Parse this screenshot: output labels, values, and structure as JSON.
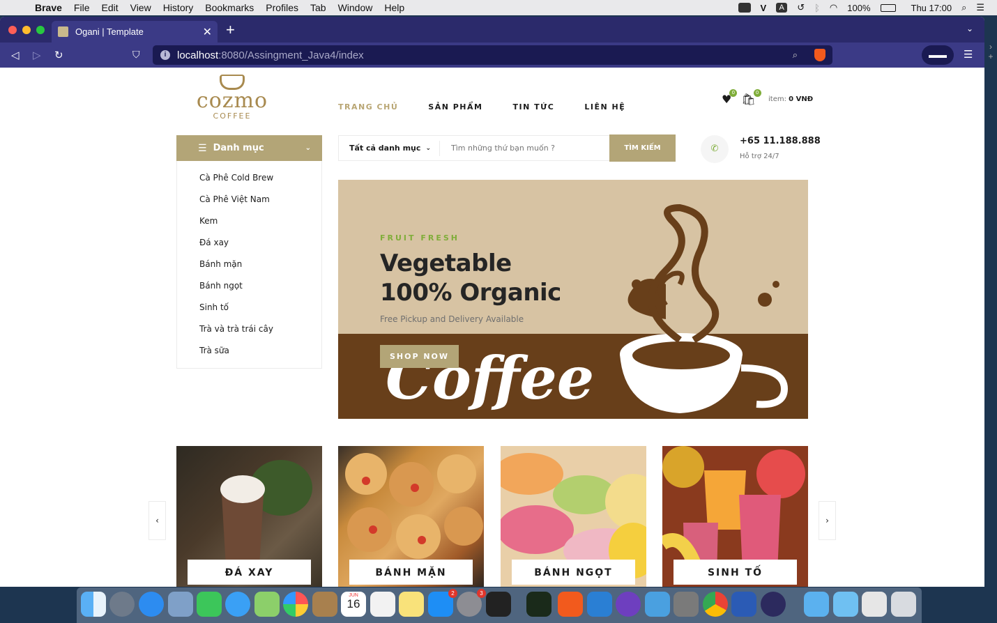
{
  "menubar": {
    "app": "Brave",
    "items": [
      "File",
      "Edit",
      "View",
      "History",
      "Bookmarks",
      "Profiles",
      "Tab",
      "Window",
      "Help"
    ],
    "battery": "100%",
    "clock": "Thu 17:00"
  },
  "browser": {
    "tab_title": "Ogani | Template",
    "url_host": "localhost",
    "url_path": ":8080/Assingment_Java4/index"
  },
  "site": {
    "logo_name": "cozmo",
    "logo_sub": "COFFEE",
    "nav": [
      "TRANG CHỦ",
      "SẢN PHẨM",
      "TIN TỨC",
      "LIÊN HỆ"
    ],
    "wishlist_count": "0",
    "cart_count": "0",
    "cart_label": "item:",
    "cart_total": "0 VNĐ",
    "categories_title": "Danh mục",
    "categories": [
      "Cà Phê Cold Brew",
      "Cà Phê Việt Nam",
      "Kem",
      "Đá xay",
      "Bánh mặn",
      "Bánh ngọt",
      "Sinh tố",
      "Trà và trà trái cây",
      "Trà sữa"
    ],
    "search_all": "Tất cả danh mục",
    "search_placeholder": "Tìm những thứ bạn muốn ?",
    "search_button": "TÌM KIẾM",
    "phone": "+65 11.188.888",
    "support": "Hỗ trợ 24/7",
    "hero": {
      "kicker": "FRUIT FRESH",
      "title_line1": "Vegetable",
      "title_line2": "100% Organic",
      "subtitle": "Free Pickup and Delivery Available",
      "button": "SHOP NOW",
      "script": "Coffee"
    },
    "featured": [
      "ĐÁ XAY",
      "BÁNH MẶN",
      "BÁNH NGỌT",
      "SINH TỐ"
    ]
  },
  "colors": {
    "accent": "#b3a577",
    "green": "#7fad39",
    "hero_bg": "#d7c3a3",
    "hero_brown": "#683f1a"
  },
  "dock": {
    "badges": [
      "2",
      "3"
    ],
    "calendar_month": "JUN",
    "calendar_day": "16"
  }
}
